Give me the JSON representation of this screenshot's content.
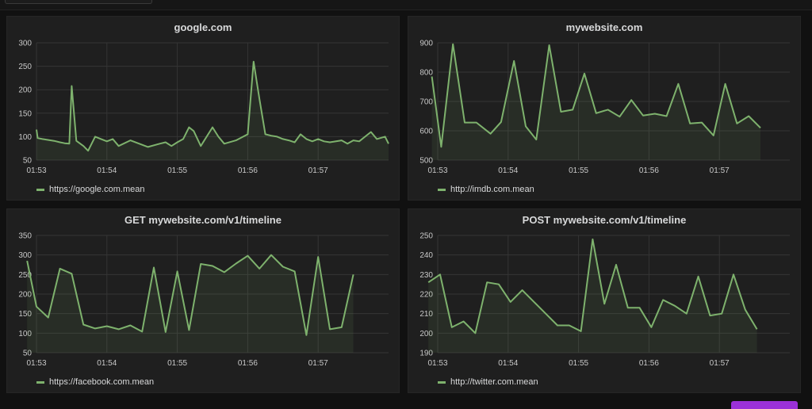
{
  "colors": {
    "series": "#7eb26d",
    "fill": "rgba(126,178,109,0.10)",
    "grid": "#353535",
    "accent": "#9b30d8"
  },
  "chart_data": [
    {
      "type": "line",
      "title": "google.com",
      "ylim": [
        50,
        300
      ],
      "yticks": [
        50,
        100,
        150,
        200,
        250,
        300
      ],
      "xtick_labels": [
        "01:53",
        "01:54",
        "01:55",
        "01:56",
        "01:57"
      ],
      "xlim": [
        0,
        300
      ],
      "xticks": [
        0,
        60,
        120,
        180,
        240
      ],
      "grid": true,
      "legend": "bottom-left",
      "series": [
        {
          "name": "https://google.com.mean",
          "x": [
            0,
            1,
            5,
            15,
            20,
            24,
            28,
            30,
            34,
            40,
            44,
            50,
            55,
            60,
            65,
            70,
            80,
            95,
            105,
            110,
            115,
            120,
            125,
            130,
            134,
            140,
            150,
            155,
            160,
            170,
            180,
            185,
            190,
            195,
            200,
            205,
            210,
            215,
            220,
            225,
            230,
            235,
            240,
            245,
            250,
            260,
            265,
            270,
            275,
            280,
            285,
            290,
            297,
            300
          ],
          "y": [
            115,
            97,
            95,
            91,
            88,
            86,
            85,
            208,
            91,
            80,
            70,
            100,
            95,
            90,
            95,
            80,
            92,
            78,
            85,
            88,
            80,
            88,
            95,
            120,
            112,
            80,
            120,
            100,
            85,
            92,
            105,
            260,
            180,
            105,
            102,
            100,
            95,
            92,
            88,
            105,
            95,
            90,
            95,
            90,
            88,
            92,
            85,
            92,
            90,
            100,
            110,
            95,
            100,
            85
          ]
        }
      ]
    },
    {
      "type": "line",
      "title": "mywebsite.com",
      "ylim": [
        500,
        900
      ],
      "yticks": [
        500,
        600,
        700,
        800,
        900
      ],
      "xtick_labels": [
        "01:53",
        "01:54",
        "01:55",
        "01:56",
        "01:57"
      ],
      "xlim": [
        0,
        300
      ],
      "xticks": [
        0,
        60,
        120,
        180,
        240
      ],
      "grid": true,
      "legend": "bottom-left",
      "series": [
        {
          "name": "http://imdb.com.mean",
          "x": [
            -5,
            3,
            13,
            23,
            33,
            45,
            54,
            65,
            75,
            84,
            95,
            105,
            115,
            125,
            135,
            145,
            155,
            165,
            175,
            185,
            195,
            205,
            215,
            225,
            235,
            245,
            255,
            265,
            275
          ],
          "y": [
            785,
            545,
            895,
            628,
            628,
            590,
            630,
            838,
            615,
            570,
            892,
            665,
            672,
            795,
            660,
            672,
            648,
            705,
            652,
            658,
            650,
            760,
            625,
            628,
            584,
            760,
            625,
            650,
            610
          ]
        }
      ]
    },
    {
      "type": "line",
      "title": "GET mywebsite.com/v1/timeline",
      "ylim": [
        50,
        350
      ],
      "yticks": [
        50,
        100,
        150,
        200,
        250,
        300,
        350
      ],
      "xtick_labels": [
        "01:53",
        "01:54",
        "01:55",
        "01:56",
        "01:57"
      ],
      "xlim": [
        0,
        300
      ],
      "xticks": [
        0,
        60,
        120,
        180,
        240
      ],
      "grid": true,
      "legend": "bottom-left",
      "series": [
        {
          "name": "https://facebook.com.mean",
          "x": [
            -8,
            0,
            10,
            20,
            30,
            40,
            50,
            60,
            70,
            80,
            90,
            100,
            110,
            120,
            130,
            140,
            150,
            160,
            170,
            180,
            190,
            200,
            210,
            220,
            230,
            240,
            250,
            260,
            270
          ],
          "y": [
            285,
            168,
            140,
            265,
            252,
            122,
            112,
            118,
            110,
            120,
            104,
            268,
            103,
            258,
            108,
            277,
            272,
            256,
            278,
            298,
            265,
            300,
            270,
            258,
            95,
            295,
            110,
            115,
            250
          ]
        }
      ]
    },
    {
      "type": "line",
      "title": "POST mywebsite.com/v1/timeline",
      "ylim": [
        190,
        250
      ],
      "yticks": [
        190,
        200,
        210,
        220,
        230,
        240,
        250
      ],
      "xtick_labels": [
        "01:53",
        "01:54",
        "01:55",
        "01:56",
        "01:57"
      ],
      "xlim": [
        0,
        300
      ],
      "xticks": [
        0,
        60,
        120,
        180,
        240
      ],
      "grid": true,
      "legend": "bottom-left",
      "series": [
        {
          "name": "http://twitter.com.mean",
          "x": [
            -8,
            2,
            12,
            22,
            32,
            42,
            52,
            62,
            72,
            82,
            92,
            102,
            112,
            122,
            132,
            142,
            152,
            162,
            172,
            182,
            192,
            202,
            212,
            222,
            232,
            242,
            252,
            262,
            272
          ],
          "y": [
            226,
            230,
            203,
            206,
            200,
            226,
            225,
            216,
            222,
            216,
            210,
            204,
            204,
            201,
            248,
            215,
            235,
            213,
            213,
            203,
            217,
            214,
            210,
            229,
            209,
            210,
            230,
            212,
            202
          ]
        }
      ]
    }
  ]
}
